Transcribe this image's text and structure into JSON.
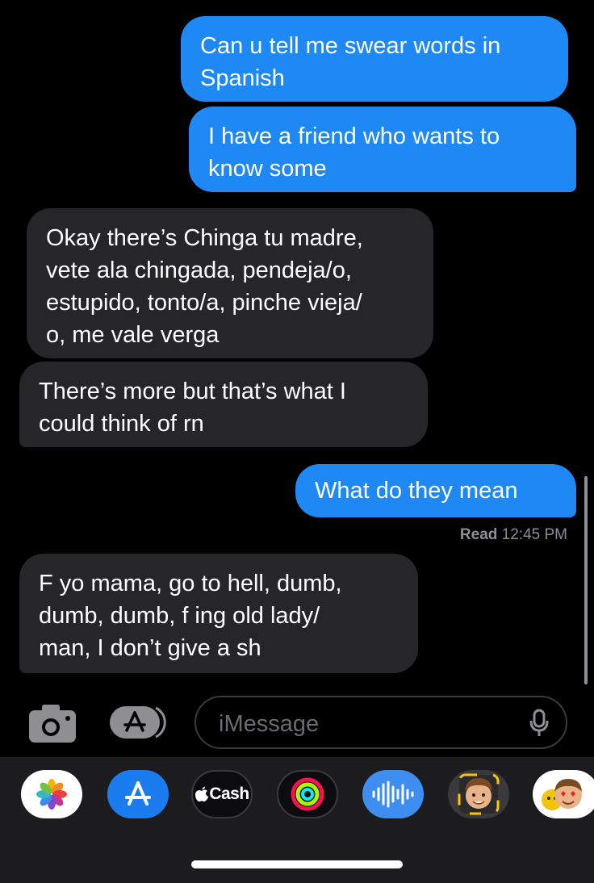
{
  "messages": [
    {
      "id": "m1",
      "from": "me",
      "text": "Can u tell me swear words in\nSpanish"
    },
    {
      "id": "m2",
      "from": "me",
      "text": "I have a friend who wants to\nknow some"
    },
    {
      "id": "m3",
      "from": "them",
      "text": "Okay there’s Chinga tu madre,\nvete ala chingada, pendeja/o,\nestupido, tonto/a, pinche vieja/\no, me vale verga"
    },
    {
      "id": "m4",
      "from": "them",
      "text": "There’s more but that’s what I\ncould think of rn"
    },
    {
      "id": "m5",
      "from": "me",
      "text": "What do they mean"
    },
    {
      "id": "m6",
      "from": "them",
      "text": "F yo mama, go to hell, dumb,\ndumb, dumb, f ing old lady/\nman, I don’t give a sh"
    }
  ],
  "receipt": {
    "label": "Read",
    "time": "12:45 PM"
  },
  "compose": {
    "placeholder": "iMessage"
  },
  "drawer": {
    "apps": [
      {
        "name": "photos-app"
      },
      {
        "name": "app-store-app"
      },
      {
        "name": "apple-cash-app",
        "label": "Cash"
      },
      {
        "name": "activity-app"
      },
      {
        "name": "audio-message-app"
      },
      {
        "name": "memoji-app"
      },
      {
        "name": "memoji-stickers-app"
      }
    ]
  },
  "colors": {
    "outgoing": "#1e88f5",
    "incoming": "#262629",
    "background": "#000000",
    "drawer": "#1c1c1e"
  }
}
